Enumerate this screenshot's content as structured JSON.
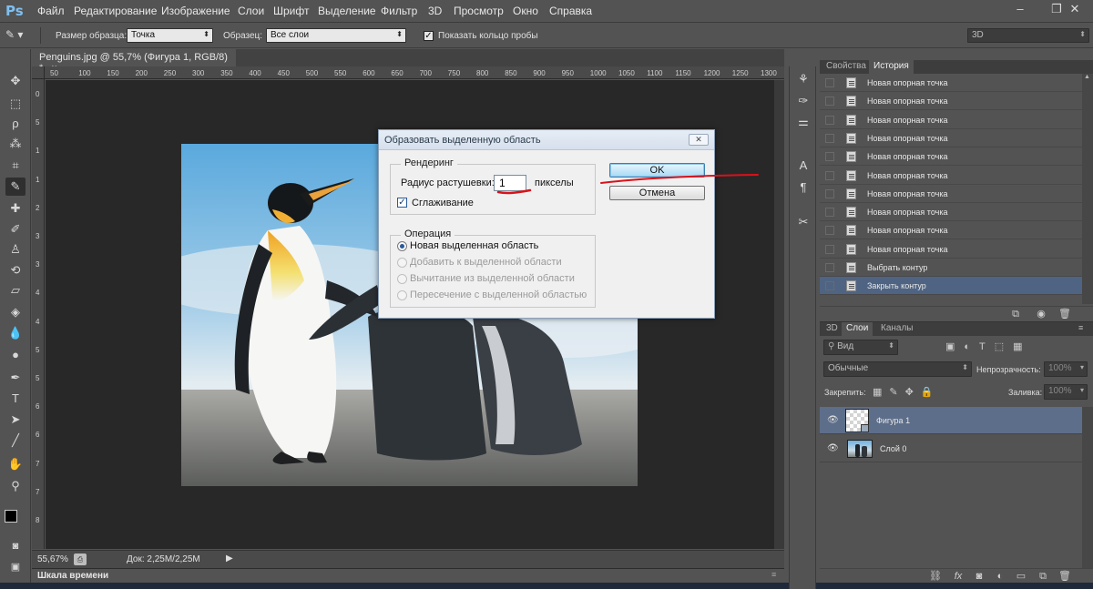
{
  "app": {
    "logo": "Ps"
  },
  "menu": [
    "Файл",
    "Редактирование",
    "Изображение",
    "Слои",
    "Шрифт",
    "Выделение",
    "Фильтр",
    "3D",
    "Просмотр",
    "Окно",
    "Справка"
  ],
  "window_controls": {
    "minimize": "–",
    "restore": "❐",
    "close": "✕"
  },
  "options_bar": {
    "sample_size_label": "Размер образца:",
    "sample_size_value": "Точка",
    "sample_label": "Образец:",
    "sample_value": "Все слои",
    "show_ring_label": "Показать кольцо пробы",
    "show_ring_checked": true,
    "workspace_value": "3D"
  },
  "document": {
    "tab_title": "Penguins.jpg @ 55,7% (Фигура 1, RGB/8) *",
    "tab_close": "×",
    "ruler_h": [
      "50",
      "100",
      "150",
      "200",
      "250",
      "300",
      "350",
      "400",
      "450",
      "500",
      "550",
      "600",
      "650",
      "700",
      "750",
      "800",
      "850",
      "900",
      "950",
      "1000",
      "1050",
      "1100",
      "1150",
      "1200",
      "1250",
      "1300"
    ],
    "ruler_v": [
      "0",
      "5",
      "1",
      "1",
      "2",
      "3",
      "3",
      "4",
      "4",
      "5",
      "5",
      "6",
      "6",
      "7",
      "7",
      "8"
    ],
    "zoom": "55,67%",
    "doc_info": "Док: 2,25M/2,25M"
  },
  "timeline": {
    "label": "Шкала времени"
  },
  "dialog": {
    "title": "Образовать выделенную область",
    "close": "✕",
    "rendering": {
      "title": "Рендеринг",
      "feather_label": "Радиус растушевки:",
      "feather_value": "1",
      "feather_unit": "пикселы",
      "antialias_label": "Сглаживание",
      "antialias_checked": true
    },
    "operation": {
      "title": "Операция",
      "options": [
        {
          "label": "Новая выделенная область",
          "selected": true,
          "enabled": true
        },
        {
          "label": "Добавить к выделенной области",
          "selected": false,
          "enabled": false
        },
        {
          "label": "Вычитание из выделенной области",
          "selected": false,
          "enabled": false
        },
        {
          "label": "Пересечение с выделенной областью",
          "selected": false,
          "enabled": false
        }
      ]
    },
    "ok_label": "OK",
    "cancel_label": "Отмена"
  },
  "history_panel": {
    "tabs": [
      "Свойства",
      "История"
    ],
    "active_tab": "История",
    "items": [
      "Новая опорная точка",
      "Новая опорная точка",
      "Новая опорная точка",
      "Новая опорная точка",
      "Новая опорная точка",
      "Новая опорная точка",
      "Новая опорная точка",
      "Новая опорная точка",
      "Новая опорная точка",
      "Новая опорная точка",
      "Выбрать контур",
      "Закрыть контур"
    ],
    "selected_index": 11
  },
  "layers_panel": {
    "tabs": [
      "3D",
      "Слои",
      "Каналы"
    ],
    "active_tab": "Слои",
    "filter_value": "Вид",
    "blend_mode": "Обычные",
    "opacity_label": "Непрозрачность:",
    "opacity_value": "100%",
    "lock_label": "Закрепить:",
    "fill_label": "Заливка:",
    "fill_value": "100%",
    "layers": [
      {
        "name": "Фигура 1",
        "selected": true
      },
      {
        "name": "Слой 0",
        "selected": false
      }
    ]
  },
  "colors": {
    "accent": "#4f6482",
    "annotation": "#d9121b",
    "dialog_bg": "#f0f0f0"
  }
}
